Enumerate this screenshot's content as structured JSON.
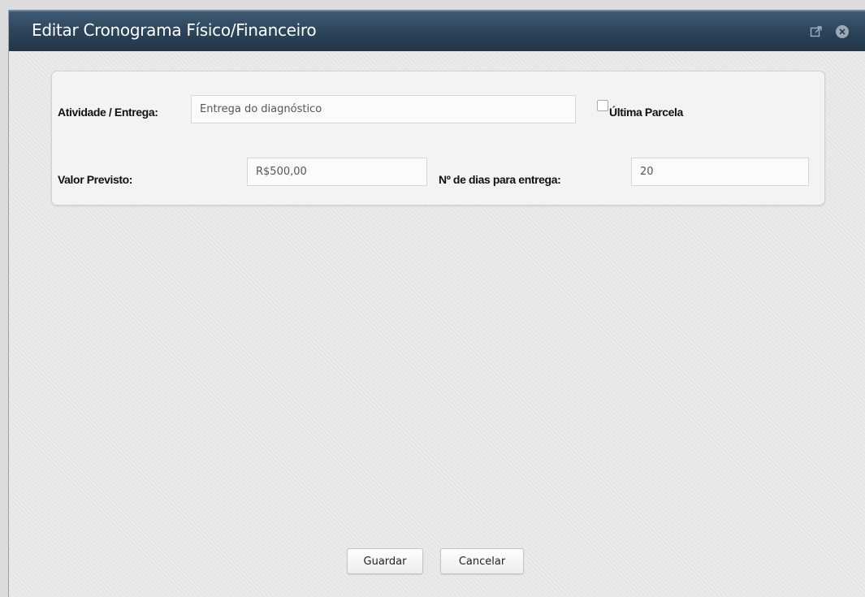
{
  "window": {
    "title": "Editar Cronograma Físico/Financeiro",
    "popout_icon": "popout-icon",
    "close_icon": "close-icon"
  },
  "form": {
    "atividade_label": "Atividade / Entrega:",
    "atividade_value": "Entrega do diagnóstico",
    "ultima_parcela_label": "Última Parcela",
    "ultima_parcela_checked": false,
    "valor_label": "Valor Previsto:",
    "valor_value": "R$500,00",
    "dias_label": "Nº de dias para entrega:",
    "dias_value": "20"
  },
  "actions": {
    "save_label": "Guardar",
    "cancel_label": "Cancelar"
  },
  "colors": {
    "titlebar": "#2b4358",
    "panel": "#f3f3f3"
  }
}
